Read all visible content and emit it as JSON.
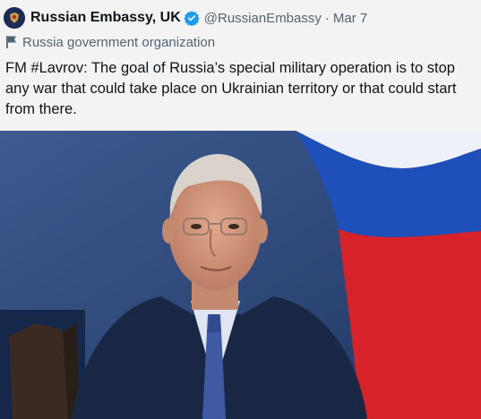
{
  "tweet": {
    "author_name": "Russian Embassy, UK",
    "handle": "@RussianEmbassy",
    "separator": "·",
    "date": "Mar 7",
    "account_label": "Russia government organization",
    "text": "FM #Lavrov: The goal of Russia’s special military operation is to stop any war that could take place on Ukrainian territory or that could start from there."
  },
  "icons": {
    "avatar": "embassy-emblem-icon",
    "verified": "verified-badge-icon",
    "label": "flag-icon"
  },
  "colors": {
    "background": "#f3f3f3",
    "text": "#0f1419",
    "secondary": "#536471",
    "verified": "#1d9bf0",
    "flag_white": "#eef1f7",
    "flag_blue": "#1f4fb8",
    "flag_red": "#d8222a",
    "backdrop": "#2f4a7c"
  }
}
